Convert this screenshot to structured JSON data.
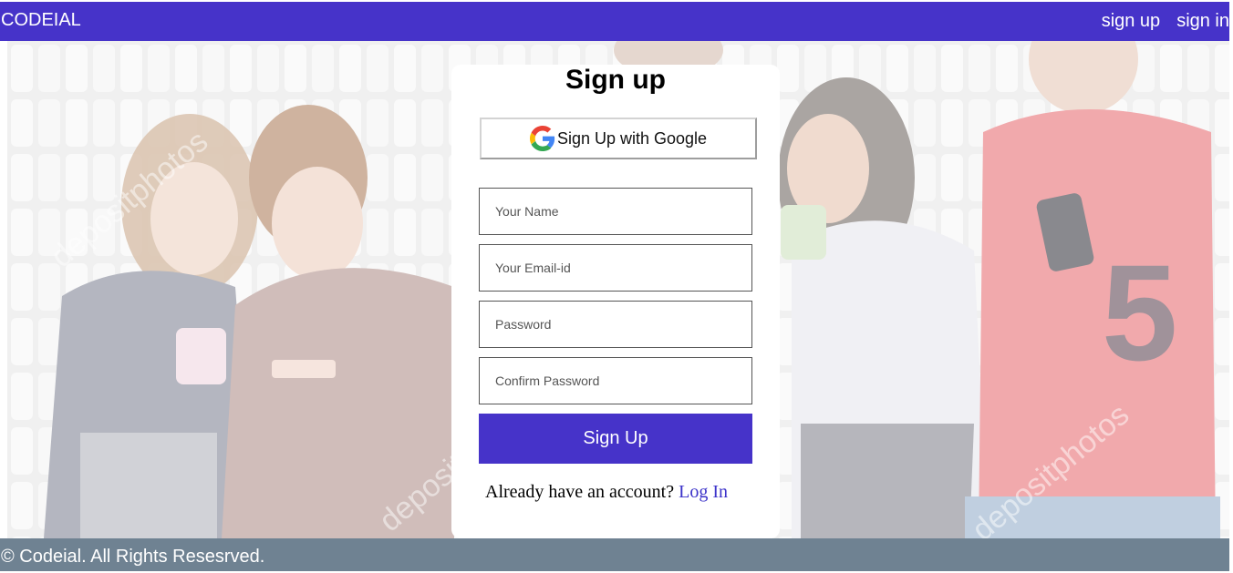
{
  "navbar": {
    "brand": "CODEIAL",
    "links": [
      "sign up",
      "sign in"
    ],
    "background_color": "#4633c9"
  },
  "hero": {
    "watermark": "depositphotos"
  },
  "signup": {
    "title": "Sign up",
    "google_button_label": "Sign Up with Google",
    "google_icon": "google-g-icon",
    "fields": {
      "name_placeholder": "Your Name",
      "email_placeholder": "Your Email-id",
      "password_placeholder": "Password",
      "confirm_password_placeholder": "Confirm Password"
    },
    "submit_label": "Sign Up",
    "login_prompt": "Already have an account?",
    "login_link": "Log In",
    "accent_color": "#4633c9"
  },
  "footer": {
    "text": "© Codeial. All Rights Resesrved.",
    "background_color": "#6f8292"
  }
}
